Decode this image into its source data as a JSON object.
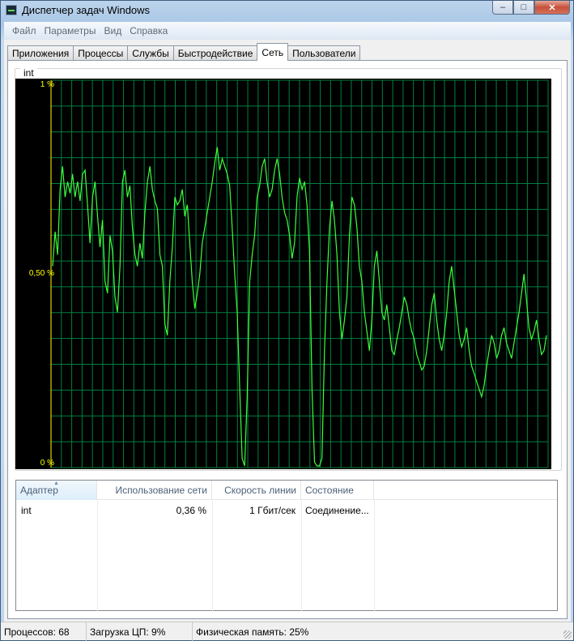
{
  "window": {
    "title": "Диспетчер задач Windows",
    "buttons": {
      "minimize": "–",
      "maximize": "□",
      "close": "✕"
    }
  },
  "menu": [
    "Файл",
    "Параметры",
    "Вид",
    "Справка"
  ],
  "tabs": [
    {
      "label": "Приложения",
      "active": false
    },
    {
      "label": "Процессы",
      "active": false
    },
    {
      "label": "Службы",
      "active": false
    },
    {
      "label": "Быстродействие",
      "active": false
    },
    {
      "label": "Сеть",
      "active": true
    },
    {
      "label": "Пользователи",
      "active": false
    }
  ],
  "network_graph": {
    "adapter": "int",
    "y_labels": {
      "top": "1 %",
      "mid": "0,50 %",
      "bottom": "0 %"
    },
    "colors": {
      "background": "#000000",
      "grid": "#008040",
      "line": "#3cff3c",
      "axis_label": "#ffff00"
    }
  },
  "chart_data": {
    "type": "line",
    "title": "int",
    "ylim": [
      0,
      1
    ],
    "grid": true,
    "series": [
      {
        "values": [
          0.52,
          0.61,
          0.55,
          0.72,
          0.78,
          0.7,
          0.74,
          0.71,
          0.76,
          0.7,
          0.74,
          0.69,
          0.76,
          0.77,
          0.68,
          0.58,
          0.7,
          0.74,
          0.65,
          0.57,
          0.64,
          0.48,
          0.45,
          0.6,
          0.56,
          0.44,
          0.4,
          0.52,
          0.74,
          0.77,
          0.7,
          0.73,
          0.62,
          0.55,
          0.52,
          0.58,
          0.54,
          0.66,
          0.74,
          0.78,
          0.72,
          0.69,
          0.67,
          0.55,
          0.52,
          0.37,
          0.34,
          0.48,
          0.57,
          0.7,
          0.68,
          0.69,
          0.72,
          0.65,
          0.68,
          0.58,
          0.48,
          0.41,
          0.45,
          0.5,
          0.58,
          0.62,
          0.66,
          0.7,
          0.74,
          0.79,
          0.83,
          0.77,
          0.8,
          0.78,
          0.76,
          0.73,
          0.62,
          0.5,
          0.4,
          0.2,
          0.02,
          0.0,
          0.18,
          0.48,
          0.55,
          0.6,
          0.7,
          0.73,
          0.78,
          0.8,
          0.74,
          0.7,
          0.72,
          0.77,
          0.8,
          0.76,
          0.7,
          0.66,
          0.64,
          0.6,
          0.54,
          0.58,
          0.7,
          0.75,
          0.72,
          0.74,
          0.68,
          0.56,
          0.2,
          0.01,
          0.0,
          0.0,
          0.02,
          0.3,
          0.48,
          0.62,
          0.69,
          0.64,
          0.55,
          0.4,
          0.33,
          0.38,
          0.44,
          0.6,
          0.7,
          0.68,
          0.62,
          0.52,
          0.48,
          0.4,
          0.35,
          0.3,
          0.38,
          0.52,
          0.56,
          0.48,
          0.4,
          0.38,
          0.42,
          0.36,
          0.3,
          0.29,
          0.33,
          0.36,
          0.4,
          0.44,
          0.42,
          0.38,
          0.35,
          0.33,
          0.29,
          0.27,
          0.25,
          0.26,
          0.3,
          0.36,
          0.42,
          0.45,
          0.38,
          0.33,
          0.3,
          0.34,
          0.4,
          0.48,
          0.52,
          0.46,
          0.4,
          0.34,
          0.31,
          0.33,
          0.36,
          0.3,
          0.26,
          0.24,
          0.22,
          0.2,
          0.18,
          0.21,
          0.26,
          0.3,
          0.34,
          0.32,
          0.28,
          0.3,
          0.34,
          0.36,
          0.32,
          0.3,
          0.28,
          0.32,
          0.36,
          0.4,
          0.45,
          0.5,
          0.43,
          0.36,
          0.33,
          0.35,
          0.38,
          0.33,
          0.29,
          0.3,
          0.34
        ]
      }
    ]
  },
  "adapter_table": {
    "columns": [
      "Адаптер",
      "Использование сети",
      "Скорость линии",
      "Состояние"
    ],
    "rows": [
      [
        "int",
        "0,36 %",
        "1 Гбит/сек",
        "Соединение..."
      ]
    ]
  },
  "status_bar": {
    "processes": "Процессов: 68",
    "cpu": "Загрузка ЦП: 9%",
    "memory": "Физическая память: 25%"
  }
}
